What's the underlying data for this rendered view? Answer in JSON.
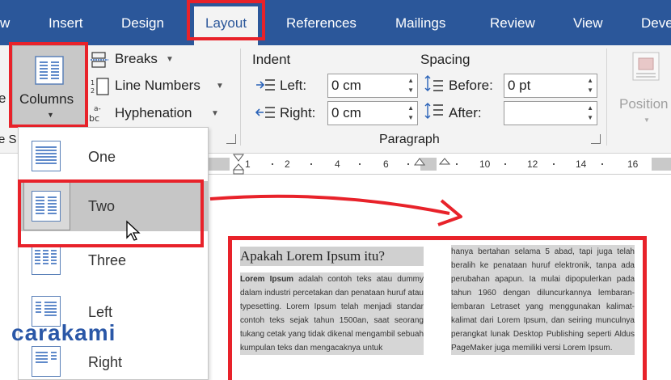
{
  "tabs": [
    "w",
    "Insert",
    "Design",
    "Layout",
    "References",
    "Mailings",
    "Review",
    "View",
    "Deve"
  ],
  "active_tab": "Layout",
  "page_setup": {
    "columns_label": "Columns",
    "left_partial": "e",
    "group_partial": "e S",
    "breaks_label": "Breaks",
    "line_numbers_label": "Line Numbers",
    "hyphenation_label": "Hyphenation"
  },
  "paragraph": {
    "indent_title": "Indent",
    "spacing_title": "Spacing",
    "left_label": "Left:",
    "right_label": "Right:",
    "left_value": "0 cm",
    "right_value": "0 cm",
    "before_label": "Before:",
    "after_label": "After:",
    "before_value": "0 pt",
    "after_value": "",
    "group_label": "Paragraph"
  },
  "arrange": {
    "position_label": "Position"
  },
  "ruler": {
    "ticks": [
      "1",
      "2",
      "4",
      "6",
      "10",
      "12",
      "14",
      "16"
    ]
  },
  "column_options": [
    {
      "label": "One"
    },
    {
      "label": "Two"
    },
    {
      "label": "Three"
    },
    {
      "label": "Left"
    },
    {
      "label": "Right"
    }
  ],
  "selected_option": "Two",
  "document": {
    "heading": "Apakah Lorem Ipsum itu?",
    "col1_bold": "Lorem Ipsum",
    "col1_text": " adalah contoh teks atau dummy dalam industri percetakan dan penataan huruf atau typesetting. Lorem Ipsum telah menjadi standar contoh teks sejak tahun 1500an, saat seorang tukang cetak yang tidak dikenal mengambil sebuah kumpulan teks dan mengacaknya untuk",
    "col2_text": "hanya bertahan selama 5 abad, tapi juga telah beralih ke penataan huruf elektronik, tanpa ada perubahan apapun. Ia mulai dipopulerkan pada tahun 1960 dengan diluncurkannya lembaran-lembaran Letraset yang menggunakan kalimat-kalimat dari Lorem Ipsum, dan seiring munculnya perangkat lunak Desktop Publishing seperti Aldus PageMaker juga memiliki versi Lorem Ipsum."
  },
  "watermark": "carakami",
  "colors": {
    "ribbon_blue": "#2b579a",
    "highlight_red": "#e8222a",
    "selection_gray": "#c6c6c6"
  }
}
